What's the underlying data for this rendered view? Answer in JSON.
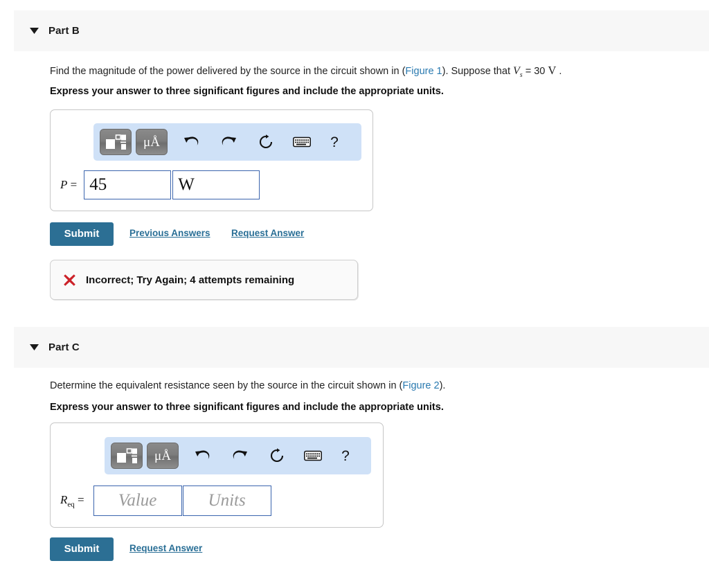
{
  "parts": [
    {
      "id": "part-b",
      "title": "Part B",
      "disclosure_icon": "triangle-down-icon",
      "prompt_segments": [
        {
          "type": "text",
          "value": "Find the magnitude of the power delivered by the source in the circuit shown in ("
        },
        {
          "type": "link",
          "value": "Figure 1"
        },
        {
          "type": "text",
          "value": "). Suppose that "
        },
        {
          "type": "var",
          "value": "V",
          "sub": "s"
        },
        {
          "type": "text",
          "value": " = 30 "
        },
        {
          "type": "unit",
          "value": "V"
        },
        {
          "type": "text",
          "value": " ."
        }
      ],
      "instruction": "Express your answer to three significant figures and include the appropriate units.",
      "answer": {
        "label_main": "P",
        "label_sub": "",
        "label_eq": "=",
        "value": "45",
        "units": "W",
        "value_placeholder": "Value",
        "units_placeholder": "Units"
      },
      "toolbar": {
        "template_button": "math-template-icon",
        "units_button": "μÅ",
        "undo": "undo-icon",
        "redo": "redo-icon",
        "reset": "reset-icon",
        "keyboard": "keyboard-icon",
        "help": "?"
      },
      "submit_label": "Submit",
      "links": [
        "Previous Answers",
        "Request Answer"
      ],
      "feedback": {
        "icon": "red-x-icon",
        "text": "Incorrect; Try Again; 4 attempts remaining",
        "color": "#cc2229"
      }
    },
    {
      "id": "part-c",
      "title": "Part C",
      "disclosure_icon": "triangle-down-icon",
      "prompt_segments": [
        {
          "type": "text",
          "value": "Determine the equivalent resistance seen by the source in the circuit shown in ("
        },
        {
          "type": "link",
          "value": "Figure 2"
        },
        {
          "type": "text",
          "value": ")."
        }
      ],
      "instruction": "Express your answer to three significant figures and include the appropriate units.",
      "answer": {
        "label_main": "R",
        "label_sub": "eq",
        "label_eq": "=",
        "value": "",
        "units": "",
        "value_placeholder": "Value",
        "units_placeholder": "Units"
      },
      "toolbar": {
        "template_button": "math-template-icon",
        "units_button": "μÅ",
        "undo": "undo-icon",
        "redo": "redo-icon",
        "reset": "reset-icon",
        "keyboard": "keyboard-icon",
        "help": "?"
      },
      "submit_label": "Submit",
      "links": [
        "Request Answer"
      ]
    }
  ],
  "colors": {
    "header_bg": "#f7f7f7",
    "link": "#2a7ab0",
    "submit": "#2c6f94",
    "toolbar_bg": "#cfe1f7",
    "input_border": "#3a64ad",
    "error": "#cc2229"
  }
}
